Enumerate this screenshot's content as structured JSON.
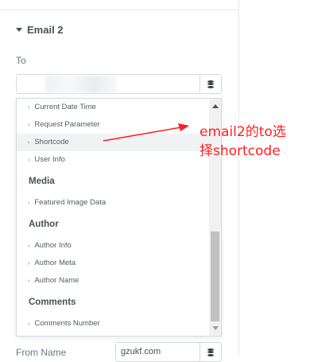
{
  "section": {
    "title": "Email 2"
  },
  "to": {
    "label": "To",
    "value": ""
  },
  "dropdown": {
    "items_top": [
      "Current Date Time",
      "Request Parameter",
      "Shortcode",
      "User Info"
    ],
    "groups": [
      {
        "title": "Media",
        "items": [
          "Featured Image Data"
        ]
      },
      {
        "title": "Author",
        "items": [
          "Author Info",
          "Author Meta",
          "Author Name"
        ]
      },
      {
        "title": "Comments",
        "items": [
          "Comments Number"
        ]
      }
    ],
    "highlighted": "Shortcode",
    "chevron": "›",
    "scroll_position_fraction": 0.6
  },
  "from_name": {
    "label": "From Name",
    "value": "gzukf.com"
  },
  "annotation": {
    "line1": "email2的to选",
    "line2": "择shortcode",
    "color": "#ff2020"
  },
  "icons": {
    "dynamic_tags": "database-icon",
    "caret": "caret-down-icon"
  }
}
